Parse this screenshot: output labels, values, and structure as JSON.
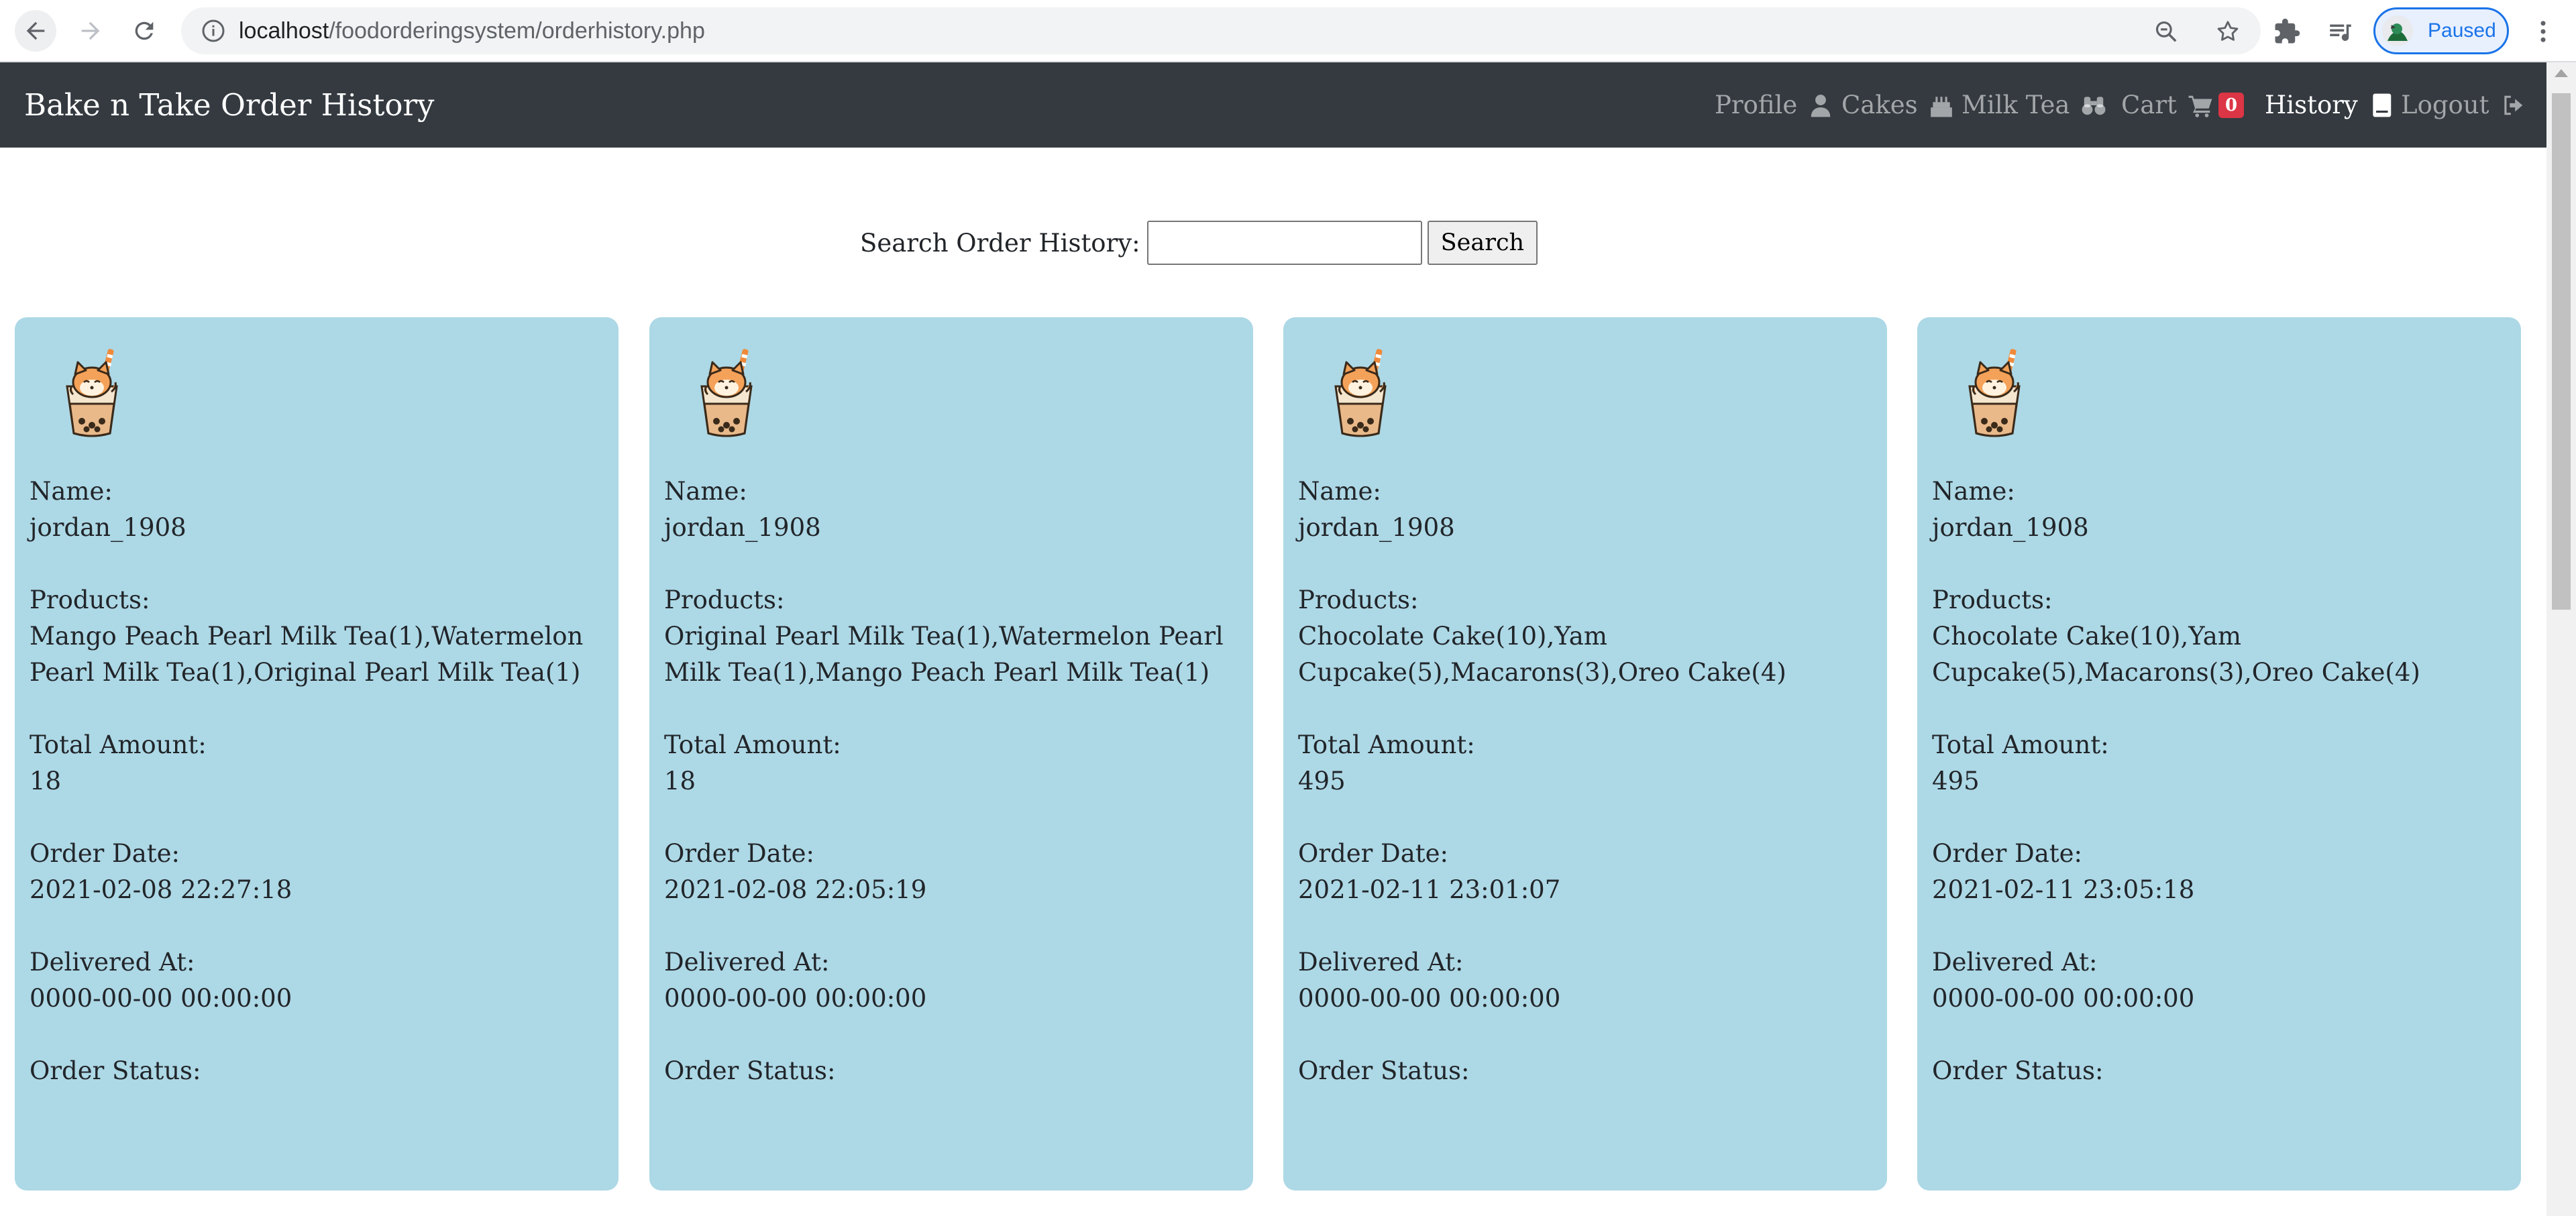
{
  "browser": {
    "url_host": "localhost",
    "url_path": "/foodorderingsystem/orderhistory.php",
    "profile_status": "Paused"
  },
  "navbar": {
    "brand": "Bake n Take Order History",
    "items": [
      {
        "label": "Profile",
        "icon": "user-icon"
      },
      {
        "label": "Cakes",
        "icon": "birthday-cake-icon"
      },
      {
        "label": "Milk Tea",
        "icon": "binoculars-icon"
      },
      {
        "label": "Cart",
        "icon": "cart-icon",
        "badge": "0"
      },
      {
        "label": "History",
        "icon": "book-icon",
        "active": true
      },
      {
        "label": "Logout",
        "icon": "sign-out-icon"
      }
    ]
  },
  "search": {
    "label": "Search Order History:",
    "value": "",
    "button_label": "Search"
  },
  "field_labels": {
    "name": "Name:",
    "products": "Products:",
    "total": "Total Amount:",
    "order_date": "Order Date:",
    "delivered": "Delivered At:",
    "status": "Order Status:"
  },
  "orders": [
    {
      "name": "jordan_1908",
      "products": "Mango Peach Pearl Milk Tea(1),Watermelon Pearl Milk Tea(1),Original Pearl Milk Tea(1)",
      "total": "18",
      "order_date": "2021-02-08 22:27:18",
      "delivered_at": "0000-00-00 00:00:00",
      "status": ""
    },
    {
      "name": "jordan_1908",
      "products": "Original Pearl Milk Tea(1),Watermelon Pearl Milk Tea(1),Mango Peach Pearl Milk Tea(1)",
      "total": "18",
      "order_date": "2021-02-08 22:05:19",
      "delivered_at": "0000-00-00 00:00:00",
      "status": ""
    },
    {
      "name": "jordan_1908",
      "products": "Chocolate Cake(10),Yam Cupcake(5),Macarons(3),Oreo Cake(4)",
      "total": "495",
      "order_date": "2021-02-11 23:01:07",
      "delivered_at": "0000-00-00 00:00:00",
      "status": ""
    },
    {
      "name": "jordan_1908",
      "products": "Chocolate Cake(10),Yam Cupcake(5),Macarons(3),Oreo Cake(4)",
      "total": "495",
      "order_date": "2021-02-11 23:05:18",
      "delivered_at": "0000-00-00 00:00:00",
      "status": ""
    }
  ],
  "colors": {
    "navbar_bg": "#343a40",
    "card_bg": "#add8e6",
    "badge_bg": "#dc3545",
    "profile_chip_accent": "#1a73e8"
  }
}
